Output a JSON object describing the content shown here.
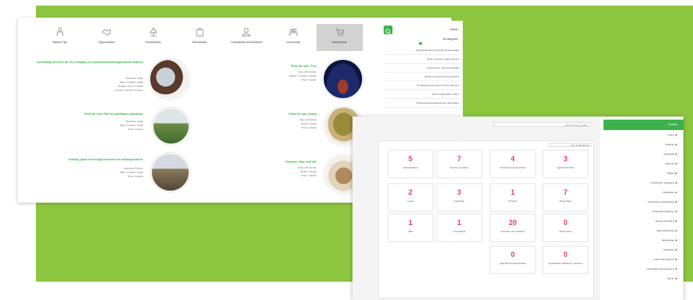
{
  "colors": {
    "accent": "#3bb24a",
    "background_block": "#8cc63f",
    "number": "#e23d5a"
  },
  "listings_window": {
    "categories": [
      {
        "label": "Market Tips",
        "icon": "person-icon"
      },
      {
        "label": "Opportunities",
        "icon": "handshake-icon"
      },
      {
        "label": "Investments",
        "icon": "tree-icon"
      },
      {
        "label": "Businesses",
        "icon": "bag-icon"
      },
      {
        "label": "Consultants and Advisors",
        "icon": "advisor-icon"
      },
      {
        "label": "Community",
        "icon": "people-icon"
      },
      {
        "label": "Marketplace",
        "icon": "cart-icon"
      }
    ],
    "listings": [
      {
        "title": "Consulting services for the Company on professional and agricultural matters",
        "meta": [
          "Business: Legal",
          "Date / Location: Israel",
          "Budget / Price: Contact",
          "Contact: Contact company"
        ]
      },
      {
        "title": "Plots for sale: Tree",
        "meta": [
          "Area: 120 dunam",
          "Region / Location: Galilee",
          "Price: Contact"
        ]
      },
      {
        "title": "Field for rent: Plot for sale/lease cultivation",
        "meta": [
          "Business: Legal",
          "Date / Location: Israel",
          "Price: Contact"
        ]
      },
      {
        "title": "Plots for sale: Arava",
        "meta": [
          "Area: 40 dunam",
          "Region: Arava",
          "Price: Contact"
        ]
      },
      {
        "title": "Inviting yards for foreign investors for land/agriculture",
        "meta": [
          "Business: Partner",
          "Date / Location: Israel",
          "Price: Contact"
        ]
      },
      {
        "title": "Farmers: Sale Unit 100",
        "meta": [
          "Area: 100 dunam",
          "Region: Negev",
          "Price: Contact"
        ]
      }
    ],
    "sidebar": {
      "header": "Search",
      "subheader": "All categories",
      "items": [
        "Agricultural land / Agricultural real estate",
        "Agric. services / Agric. service",
        "Investments - land and capital",
        "Capital investments and projects",
        "Professional services for land / farmers",
        "Jobs in agriculture / labor",
        "Professional knowledge and information"
      ]
    }
  },
  "dashboard_window": {
    "search_placeholder": "Search in the system",
    "panel_header": "List of categories",
    "tiles": [
      {
        "value": "5",
        "label": "Administration"
      },
      {
        "value": "7",
        "label": "Service providers"
      },
      {
        "value": "4",
        "label": "Investment opportunities"
      },
      {
        "value": "3",
        "label": "Agricultural land"
      },
      {
        "value": "2",
        "label": "Loans"
      },
      {
        "value": "3",
        "label": "Franchise"
      },
      {
        "value": "1",
        "label": "Projects"
      },
      {
        "value": "7",
        "label": "Real estate"
      },
      {
        "value": "1",
        "label": "Jobs"
      },
      {
        "value": "1",
        "label": "Consultants"
      },
      {
        "value": "20",
        "label": "Investors and partners"
      },
      {
        "value": "0",
        "label": "Businesses"
      },
      {
        "value": "0",
        "label": "Agricultural opportunities"
      },
      {
        "value": "0",
        "label": "Agricultural marketing / services"
      }
    ],
    "sidebar": {
      "active": "Home",
      "items": [
        "Users",
        "Settings",
        "Requests",
        "Reports",
        "Pages",
        "Investment managers",
        "Categories",
        "Investment opportunities",
        "Financial institutions",
        "Service providers",
        "Agricultural land",
        "Real estate",
        "Franchise",
        "Loans and partners",
        "Consultants and investors",
        "Admin"
      ]
    }
  }
}
